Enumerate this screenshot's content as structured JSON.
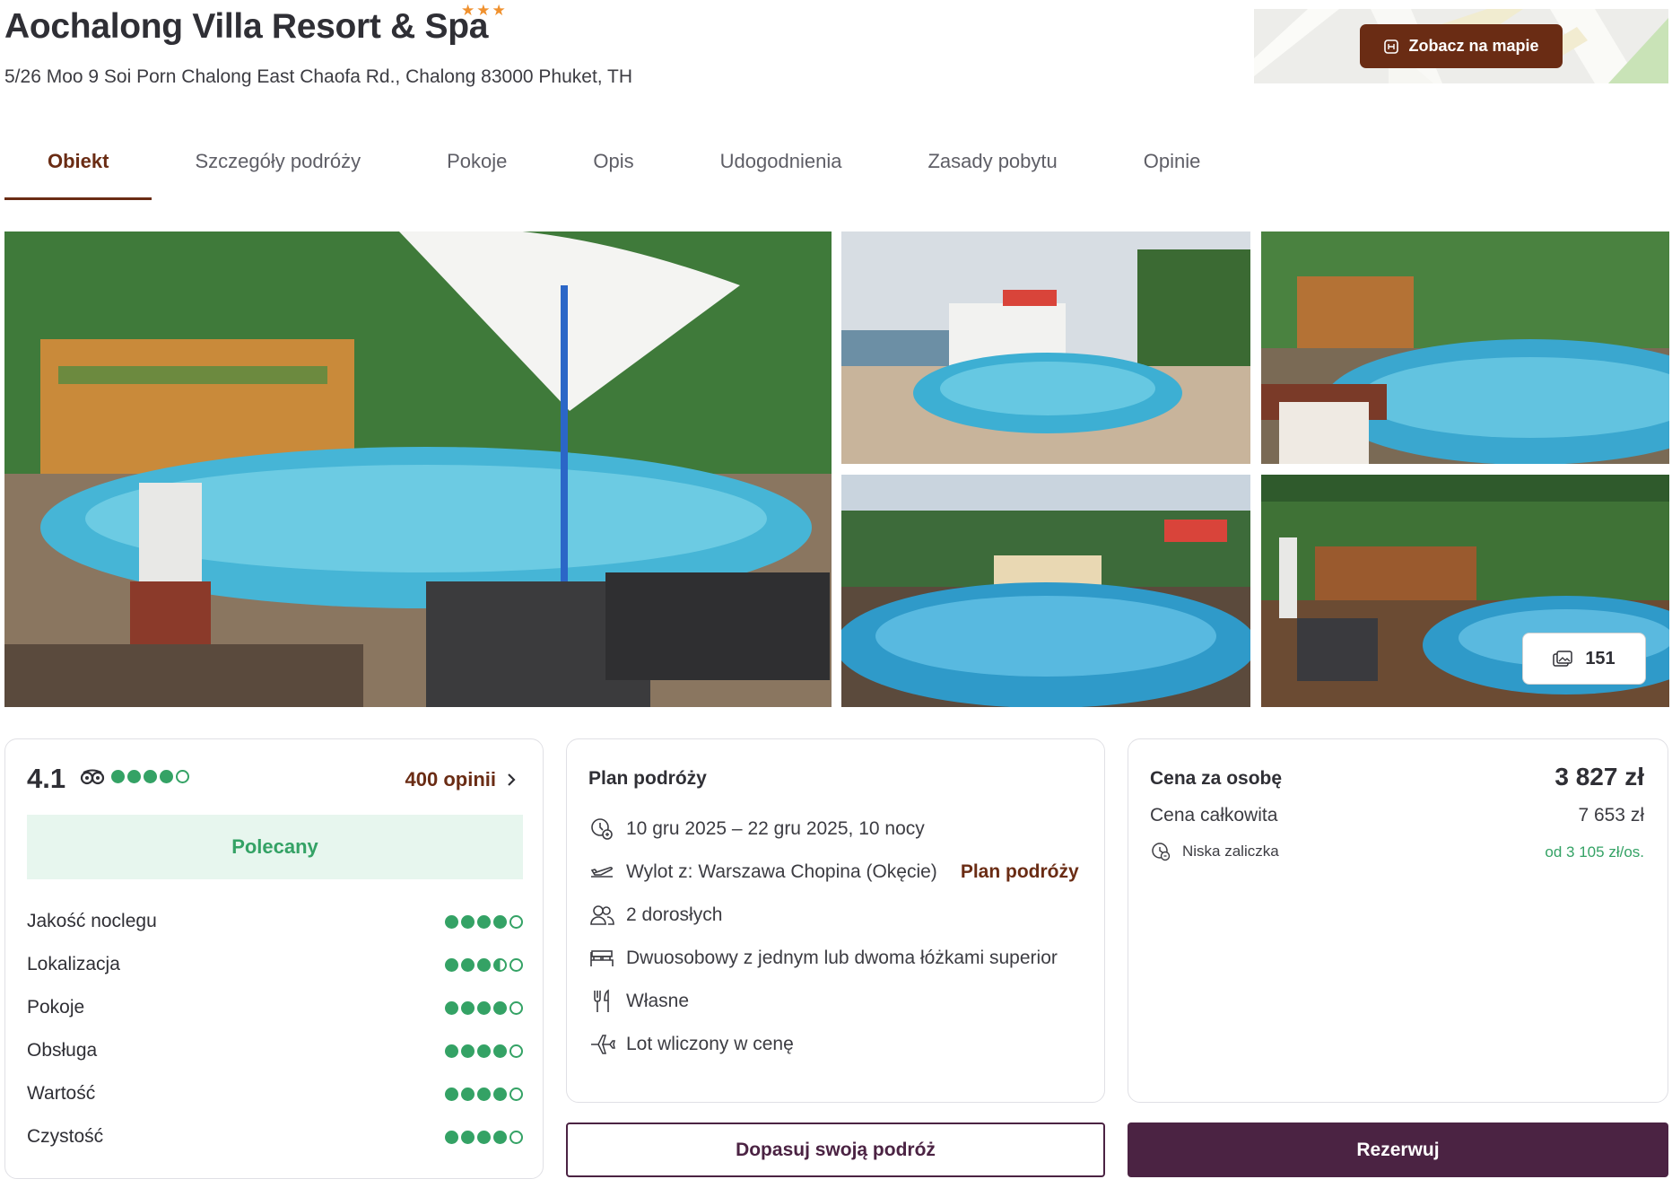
{
  "hotel": {
    "name": "Aochalong Villa Resort & Spa",
    "stars": 3,
    "stars_display": "★★★",
    "address": "5/26 Moo 9 Soi Porn Chalong East Chaofa Rd., Chalong 83000 Phuket, TH"
  },
  "map": {
    "button_label": "Zobacz na mapie",
    "icon": "map-icon"
  },
  "tabs": [
    {
      "label": "Obiekt",
      "active": true
    },
    {
      "label": "Szczegóły podróży",
      "active": false
    },
    {
      "label": "Pokoje",
      "active": false
    },
    {
      "label": "Opis",
      "active": false
    },
    {
      "label": "Udogodnienia",
      "active": false
    },
    {
      "label": "Zasady pobytu",
      "active": false
    },
    {
      "label": "Opinie",
      "active": false
    }
  ],
  "gallery": {
    "photo_count": "151",
    "icon": "gallery-icon"
  },
  "reviews": {
    "score": "4.1",
    "score_dots": 4,
    "opinions_label": "400 opinii",
    "recommended_label": "Polecany",
    "categories": [
      {
        "label": "Jakość noclegu",
        "dots": 4
      },
      {
        "label": "Lokalizacja",
        "dots": 3.5
      },
      {
        "label": "Pokoje",
        "dots": 4
      },
      {
        "label": "Obsługa",
        "dots": 4
      },
      {
        "label": "Wartość",
        "dots": 4
      },
      {
        "label": "Czystość",
        "dots": 4
      }
    ]
  },
  "plan": {
    "title": "Plan podróży",
    "dates": "10 gru 2025 – 22 gru 2025, 10 nocy",
    "departure": "Wylot z: Warszawa Chopina (Okęcie)",
    "departure_link": "Plan podróży",
    "travelers": "2 dorosłych",
    "room": "Dwuosobowy z jednym lub dwoma łóżkami superior",
    "board": "Własne",
    "flight": "Lot wliczony w cenę"
  },
  "price": {
    "per_person_label": "Cena za osobę",
    "per_person_value": "3 827 zł",
    "total_label": "Cena całkowita",
    "total_value": "7 653 zł",
    "deposit_label": "Niska zaliczka",
    "deposit_value": "od 3 105 zł/os."
  },
  "actions": {
    "adjust_label": "Dopasuj swoją podróż",
    "book_label": "Rezerwuj"
  },
  "colors": {
    "accent_brown": "#6a2c14",
    "accent_plum": "#4b2343",
    "rating_green": "#34a265",
    "star_orange": "#f0912e"
  }
}
